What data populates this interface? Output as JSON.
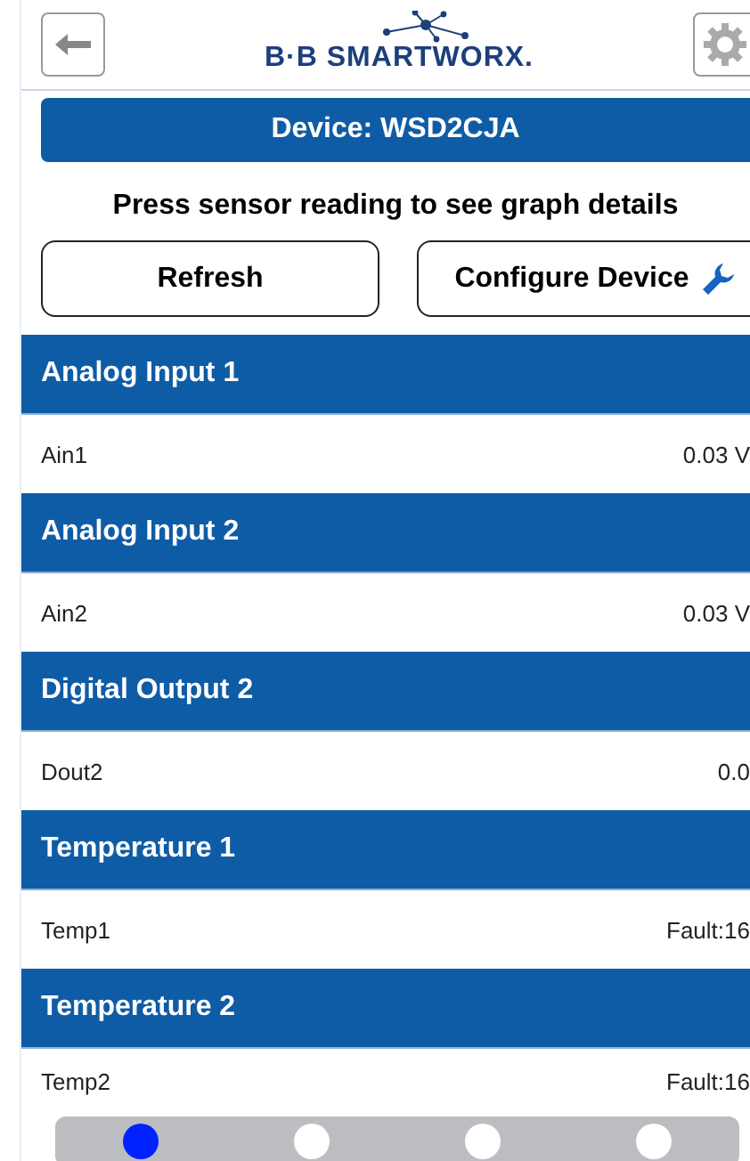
{
  "header": {
    "logo": "B·B SMARTWORX."
  },
  "device_bar": {
    "title": "Device: WSD2CJA"
  },
  "hint": "Press sensor reading to see graph details",
  "buttons": [
    {
      "label": "Refresh",
      "kind": "plain"
    },
    {
      "label": "Configure Device",
      "kind": "wrench"
    }
  ],
  "sections": [
    {
      "title": "Analog Input 1",
      "name": "Ain1",
      "value": "0.03 V"
    },
    {
      "title": "Analog Input 2",
      "name": "Ain2",
      "value": "0.03 V"
    },
    {
      "title": "Digital Output 2",
      "name": "Dout2",
      "value": "0.0"
    },
    {
      "title": "Temperature 1",
      "name": "Temp1",
      "value": "Fault:16"
    },
    {
      "title": "Temperature 2",
      "name": "Temp2",
      "value": "Fault:16"
    }
  ],
  "pager": [
    {
      "selected": true
    },
    {
      "selected": false
    },
    {
      "selected": false
    },
    {
      "selected": false
    }
  ]
}
